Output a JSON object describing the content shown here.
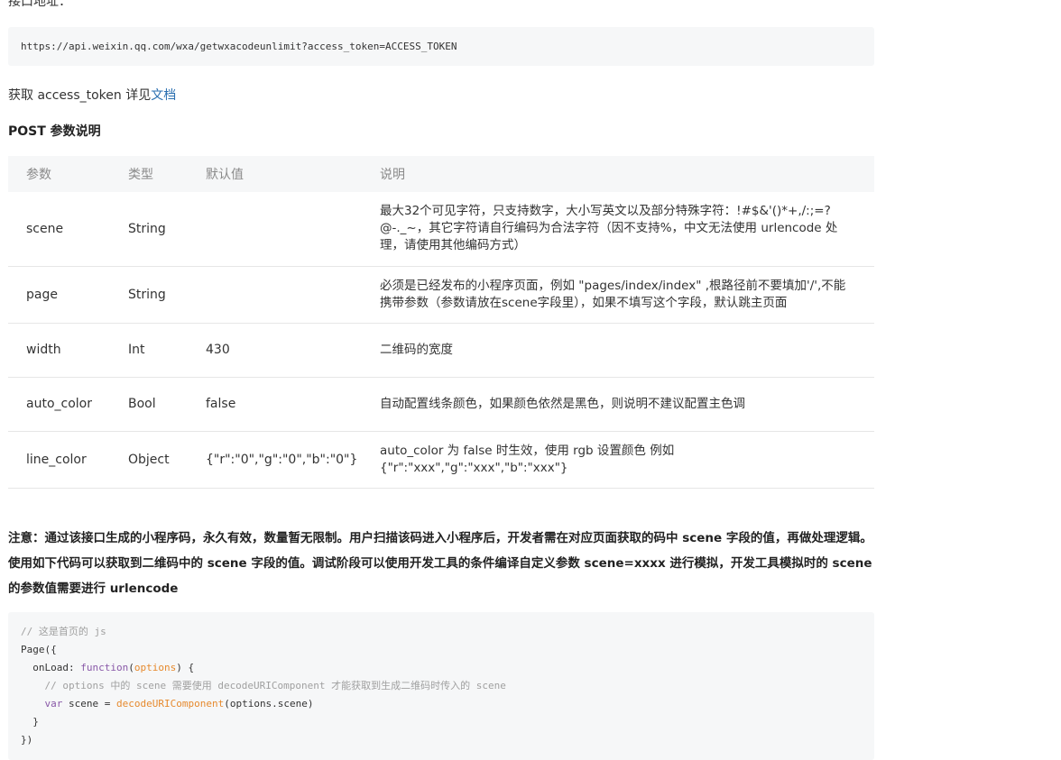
{
  "page": {
    "api_label": "接口地址：",
    "api_url": "https://api.weixin.qq.com/wxa/getwxacodeunlimit?access_token=ACCESS_TOKEN",
    "token_text": "获取 access_token 详见",
    "token_link": "文档",
    "post_title": "POST 参数说明"
  },
  "table": {
    "headers": [
      "参数",
      "类型",
      "默认值",
      "说明"
    ],
    "rows": [
      {
        "name": "scene",
        "type": "String",
        "default": "",
        "desc": "最大32个可见字符，只支持数字，大小写英文以及部分特殊字符：!#$&'()*+,/:;=?@-._~，其它字符请自行编码为合法字符（因不支持%，中文无法使用 urlencode 处理，请使用其他编码方式）"
      },
      {
        "name": "page",
        "type": "String",
        "default": "",
        "desc": "必须是已经发布的小程序页面，例如 \"pages/index/index\" ,根路径前不要填加'/',不能携带参数（参数请放在scene字段里），如果不填写这个字段，默认跳主页面"
      },
      {
        "name": "width",
        "type": "Int",
        "default": "430",
        "desc": "二维码的宽度"
      },
      {
        "name": "auto_color",
        "type": "Bool",
        "default": "false",
        "desc": "自动配置线条颜色，如果颜色依然是黑色，则说明不建议配置主色调"
      },
      {
        "name": "line_color",
        "type": "Object",
        "default": "{\"r\":\"0\",\"g\":\"0\",\"b\":\"0\"}",
        "desc": "auto_color 为 false 时生效，使用 rgb 设置颜色 例如 {\"r\":\"xxx\",\"g\":\"xxx\",\"b\":\"xxx\"}"
      }
    ]
  },
  "note": "注意：通过该接口生成的小程序码，永久有效，数量暂无限制。用户扫描该码进入小程序后，开发者需在对应页面获取的码中 scene 字段的值，再做处理逻辑。使用如下代码可以获取到二维码中的 scene 字段的值。调试阶段可以使用开发工具的条件编译自定义参数 scene=xxxx 进行模拟，开发工具模拟时的 scene 的参数值需要进行 urlencode",
  "code": {
    "line1": "// 这是首页的 js",
    "line2": "Page({",
    "line3_prop": "  onLoad: ",
    "line3_kw": "function",
    "line3_open": "(",
    "line3_param": "options",
    "line3_close": ") {",
    "line4": "    // options 中的 scene 需要使用 decodeURIComponent 才能获取到生成二维码时传入的 scene",
    "line5_indent": "    ",
    "line5_kw": "var",
    "line5_mid": " scene = ",
    "line5_func": "decodeURIComponent",
    "line5_rest": "(options.scene)",
    "line6": "  }",
    "line7": "})"
  },
  "colors": {
    "link": "#2a6fb0",
    "code_bg": "#f6f7f8",
    "keyword": "#8959a8",
    "param": "#e68a2e"
  }
}
